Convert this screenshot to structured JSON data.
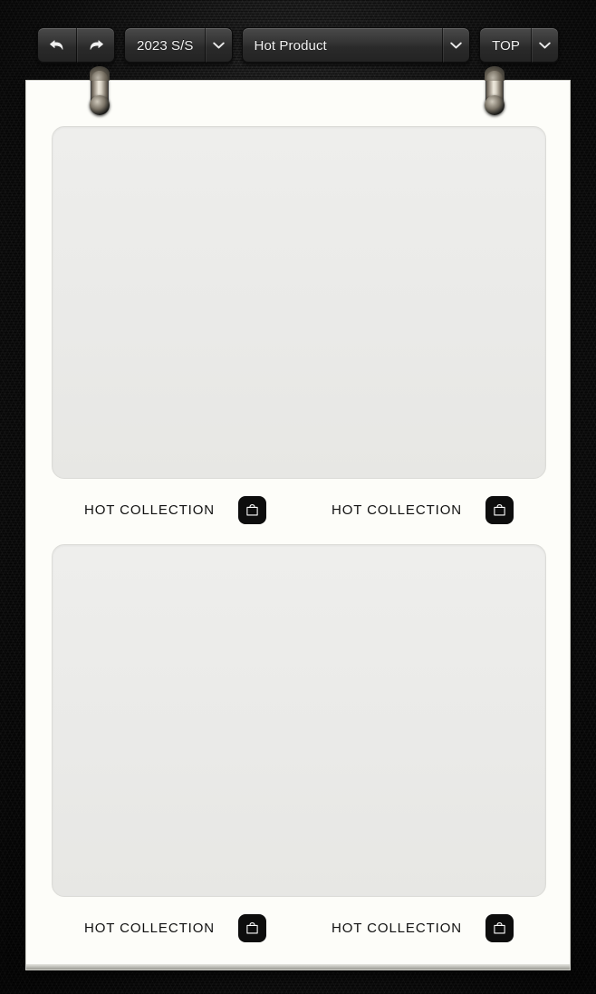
{
  "toolbar": {
    "undo": {
      "label": "Undo",
      "icon": "undo-arrow-icon"
    },
    "redo": {
      "label": "Redo",
      "icon": "redo-arrow-icon"
    },
    "season_select": {
      "value": "2023 S/S",
      "caret_icon": "chevron-down-icon"
    },
    "category_select": {
      "value": "Hot Product",
      "caret_icon": "chevron-down-icon"
    },
    "position_select": {
      "value": "TOP",
      "caret_icon": "chevron-down-icon"
    }
  },
  "page": {
    "pins": [
      {
        "name": "binder-pin-left"
      },
      {
        "name": "binder-pin-right"
      }
    ],
    "blocks": [
      {
        "media_placeholder": "",
        "captions": [
          {
            "text": "HOT COLLECTION",
            "action_icon": "shopping-bag-icon"
          },
          {
            "text": "HOT COLLECTION",
            "action_icon": "shopping-bag-icon"
          }
        ]
      },
      {
        "media_placeholder": "",
        "captions": [
          {
            "text": "HOT COLLECTION",
            "action_icon": "shopping-bag-icon"
          },
          {
            "text": "HOT COLLECTION",
            "action_icon": "shopping-bag-icon"
          }
        ]
      }
    ]
  },
  "colors": {
    "frame": "#141414",
    "paper": "#fdfdf9",
    "placeholder": "#eaeae8",
    "accent_dark": "#0d0d0d",
    "toolbar_text": "#f2f2f2"
  }
}
